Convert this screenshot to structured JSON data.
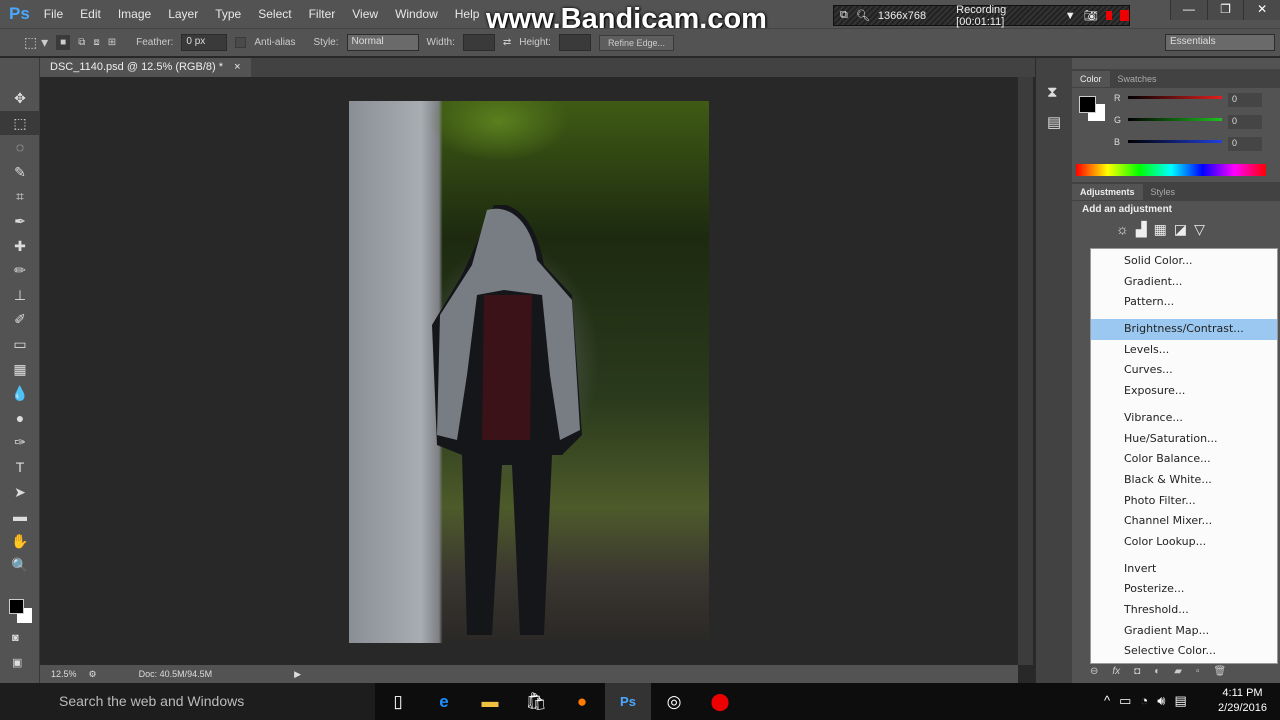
{
  "app": {
    "logo": "Ps",
    "menu": [
      "File",
      "Edit",
      "Image",
      "Layer",
      "Type",
      "Select",
      "Filter",
      "View",
      "Window",
      "Help"
    ]
  },
  "watermark": "www.Bandicam.com",
  "recorder": {
    "resolution": "1366x768",
    "status": "Recording [00:01:11]"
  },
  "window_controls": [
    "—",
    "❐",
    "✕"
  ],
  "options": {
    "feather_label": "Feather:",
    "feather_value": "0 px",
    "antialias_label": "Anti-alias",
    "style_label": "Style:",
    "style_value": "Normal",
    "width_label": "Width:",
    "height_label": "Height:",
    "refine_edge": "Refine Edge...",
    "workspace": "Essentials"
  },
  "document": {
    "tab_title": "DSC_1140.psd @ 12.5% (RGB/8) *",
    "close": "×"
  },
  "tools": [
    "move",
    "marquee",
    "lasso",
    "quick-select",
    "crop",
    "eyedropper",
    "healing",
    "brush",
    "stamp",
    "history-brush",
    "eraser",
    "gradient",
    "blur",
    "dodge",
    "pen",
    "type",
    "path-select",
    "rectangle",
    "hand",
    "zoom"
  ],
  "tool_glyphs": [
    "✥",
    "⬚",
    "◌",
    "✎",
    "⌗",
    "✒",
    "✚",
    "✏",
    "⊥",
    "✐",
    "▭",
    "▦",
    "💧",
    "●",
    "✑",
    "T",
    "➤",
    "▬",
    "✋",
    "🔍"
  ],
  "color_panel": {
    "tabs": [
      "Color",
      "Swatches"
    ],
    "channels": [
      {
        "label": "R",
        "value": "0",
        "color": "#e02020"
      },
      {
        "label": "G",
        "value": "0",
        "color": "#20c020"
      },
      {
        "label": "B",
        "value": "0",
        "color": "#2040e0"
      }
    ]
  },
  "adjustments_panel": {
    "tabs": [
      "Adjustments",
      "Styles"
    ],
    "title": "Add an adjustment"
  },
  "adjustment_menu": {
    "groups": [
      [
        "Solid Color...",
        "Gradient...",
        "Pattern..."
      ],
      [
        "Brightness/Contrast...",
        "Levels...",
        "Curves...",
        "Exposure..."
      ],
      [
        "Vibrance...",
        "Hue/Saturation...",
        "Color Balance...",
        "Black & White...",
        "Photo Filter...",
        "Channel Mixer...",
        "Color Lookup..."
      ],
      [
        "Invert",
        "Posterize...",
        "Threshold...",
        "Gradient Map...",
        "Selective Color..."
      ]
    ],
    "highlighted": "Brightness/Contrast..."
  },
  "statusbar": {
    "zoom": "12.5%",
    "doc": "Doc: 40.5M/94.5M"
  },
  "taskbar": {
    "search_placeholder": "Search the web and Windows",
    "time": "4:11 PM",
    "date": "2/29/2016"
  },
  "colors": {
    "accent": "#9ac8f0",
    "ps_blue": "#4aa8ff"
  }
}
